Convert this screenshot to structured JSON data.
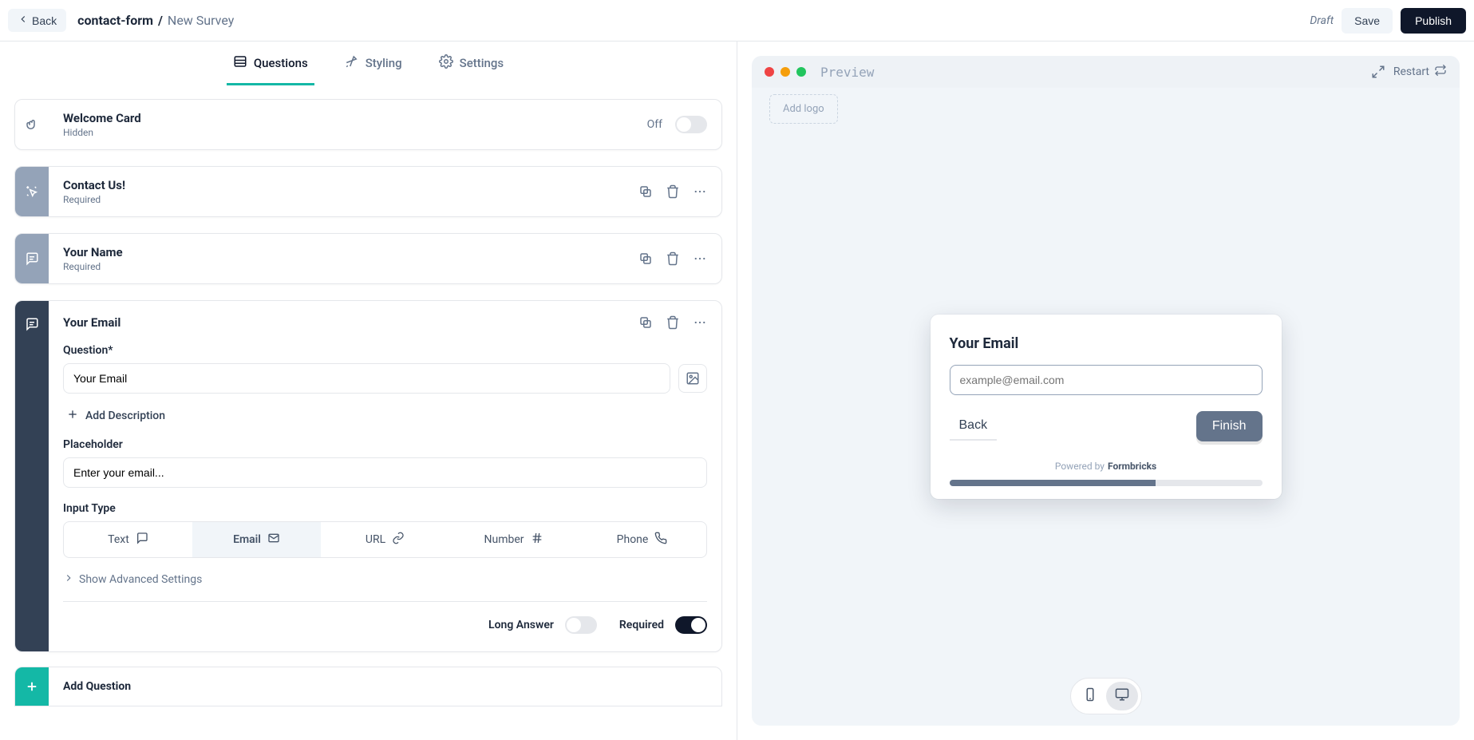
{
  "topbar": {
    "back_label": "Back",
    "project_name": "contact-form",
    "breadcrumb_sep": "/",
    "survey_name": "New Survey",
    "status_label": "Draft",
    "save_label": "Save",
    "publish_label": "Publish"
  },
  "tabs": {
    "questions": "Questions",
    "styling": "Styling",
    "settings": "Settings"
  },
  "welcome_card": {
    "title": "Welcome Card",
    "subtitle": "Hidden",
    "toggle_label": "Off"
  },
  "questions": [
    {
      "title": "Contact Us!",
      "subtitle": "Required"
    },
    {
      "title": "Your Name",
      "subtitle": "Required"
    }
  ],
  "active_question": {
    "title": "Your Email",
    "question_label": "Question*",
    "question_value": "Your Email",
    "add_description_label": "Add Description",
    "placeholder_label": "Placeholder",
    "placeholder_value": "Enter your email...",
    "input_type_label": "Input Type",
    "input_types": {
      "text": "Text",
      "email": "Email",
      "url": "URL",
      "number": "Number",
      "phone": "Phone"
    },
    "advanced_label": "Show Advanced Settings",
    "long_answer_label": "Long Answer",
    "required_label": "Required"
  },
  "add_question_label": "Add Question",
  "preview": {
    "label": "Preview",
    "restart_label": "Restart",
    "addlogo_label": "Add logo",
    "survey_title": "Your Email",
    "input_placeholder": "example@email.com",
    "back_label": "Back",
    "finish_label": "Finish",
    "powered_prefix": "Powered by",
    "powered_brand": "Formbricks",
    "progress_percent": 66
  },
  "colors": {
    "accent_teal": "#14b8a6",
    "slate_dark": "#0f172a",
    "slate_mid": "#64748b"
  }
}
